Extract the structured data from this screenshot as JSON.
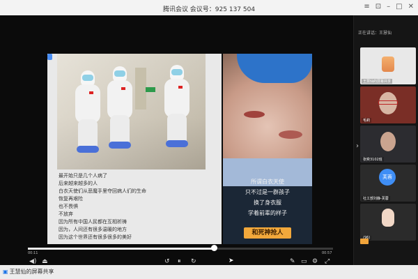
{
  "titlebar": {
    "title": "腾讯会议 会议号：925 137 504",
    "icons": [
      "menu-icon",
      "pin-icon",
      "minimize-icon",
      "maximize-icon",
      "close-icon"
    ]
  },
  "slide": {
    "lines": [
      "最开始只是几个人病了",
      "后来越来越多的人",
      "白衣天使们从恶魔手里夺回病人们的生命",
      "恢复再艰险",
      "也不畏惧",
      "不放弃",
      "因为所有中国人民都在互相祈祷",
      "因为，人间还有很多温暖的地方",
      "因为这个世界还有很多很多的美好"
    ],
    "poem": [
      "所谓白衣天使",
      "只不过是一群孩子",
      "换了身衣服",
      "学着前辈的样子"
    ],
    "banner": "和死神抢人"
  },
  "player": {
    "time_start": "00:11",
    "time_end": "00:57",
    "progress": 0.61
  },
  "panel": {
    "speaking": "正在讲话：王慧仙",
    "participants": [
      {
        "label": "王慧仙的屏幕共享"
      },
      {
        "label": "毛莉"
      },
      {
        "label": "张奕3102班"
      },
      {
        "label": "社工部刘静-芙蓉",
        "avatar_text": "芙蓉"
      },
      {
        "label": "(96)"
      }
    ]
  },
  "bottombar": {
    "share_label": "王慧仙的屏幕共享"
  },
  "colors": {
    "accent": "#3f8ef5",
    "banner": "#f2a83b",
    "background": "#101010"
  }
}
